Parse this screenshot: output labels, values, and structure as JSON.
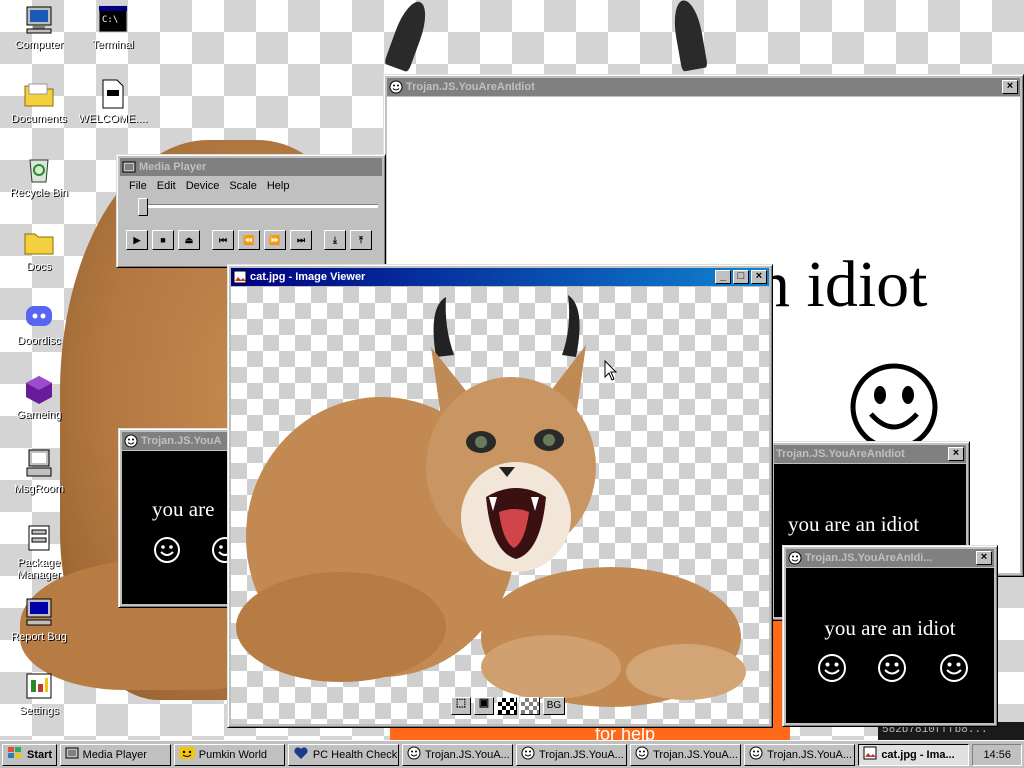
{
  "desktop": {
    "icons": [
      {
        "label": "Computer",
        "icon": "computer-icon"
      },
      {
        "label": "Terminal",
        "icon": "terminal-icon"
      },
      {
        "label": "Documents",
        "icon": "documents-folder-icon"
      },
      {
        "label": "WELCOME....",
        "icon": "document-icon"
      },
      {
        "label": "Recycle Bin",
        "icon": "recycle-bin-icon"
      },
      {
        "label": "Docs",
        "icon": "folder-icon"
      },
      {
        "label": "Doordisc",
        "icon": "discord-icon"
      },
      {
        "label": "Gameing",
        "icon": "game-cube-icon"
      },
      {
        "label": "MsgRoom",
        "icon": "msgroom-icon"
      },
      {
        "label": "Package Manager",
        "icon": "package-manager-icon"
      },
      {
        "label": "Report Bug",
        "icon": "report-bug-icon"
      },
      {
        "label": "Settings",
        "icon": "settings-icon"
      }
    ]
  },
  "big_idiot": {
    "title": "Trojan.JS.YouAreAnIdiot",
    "text": "n idiot"
  },
  "media_player": {
    "title": "Media Player",
    "menu": [
      "File",
      "Edit",
      "Device",
      "Scale",
      "Help"
    ]
  },
  "image_viewer": {
    "title": "cat.jpg - Image Viewer",
    "toolbar": [
      "fit-icon",
      "actual-size-icon",
      "checker-icon",
      "checker-alt-icon"
    ],
    "bg_label": "BG"
  },
  "idiot_left": {
    "title": "Trojan.JS.YouA",
    "text": "you are"
  },
  "idiot_mid": {
    "title": "Trojan.JS.YouAreAnIdiot",
    "text": "you are an idiot"
  },
  "idiot_front": {
    "title": "Trojan.JS.YouAreAnIdi...",
    "text": "you are an idiot"
  },
  "behind_text": {
    "help": "for help",
    "hash": "582b7810fffb8..."
  },
  "taskbar": {
    "start": "Start",
    "items": [
      {
        "label": "Media Player",
        "icon": "media-player-icon"
      },
      {
        "label": "Pumkin World",
        "icon": "smiley-icon"
      },
      {
        "label": "PC Health Check",
        "icon": "heart-icon"
      },
      {
        "label": "Trojan.JS.YouA...",
        "icon": "smiley-icon"
      },
      {
        "label": "Trojan.JS.YouA...",
        "icon": "smiley-icon"
      },
      {
        "label": "Trojan.JS.YouA...",
        "icon": "smiley-icon"
      },
      {
        "label": "Trojan.JS.YouA...",
        "icon": "smiley-icon"
      },
      {
        "label": "cat.jpg - Ima...",
        "icon": "image-icon"
      }
    ],
    "clock": "14:56"
  }
}
